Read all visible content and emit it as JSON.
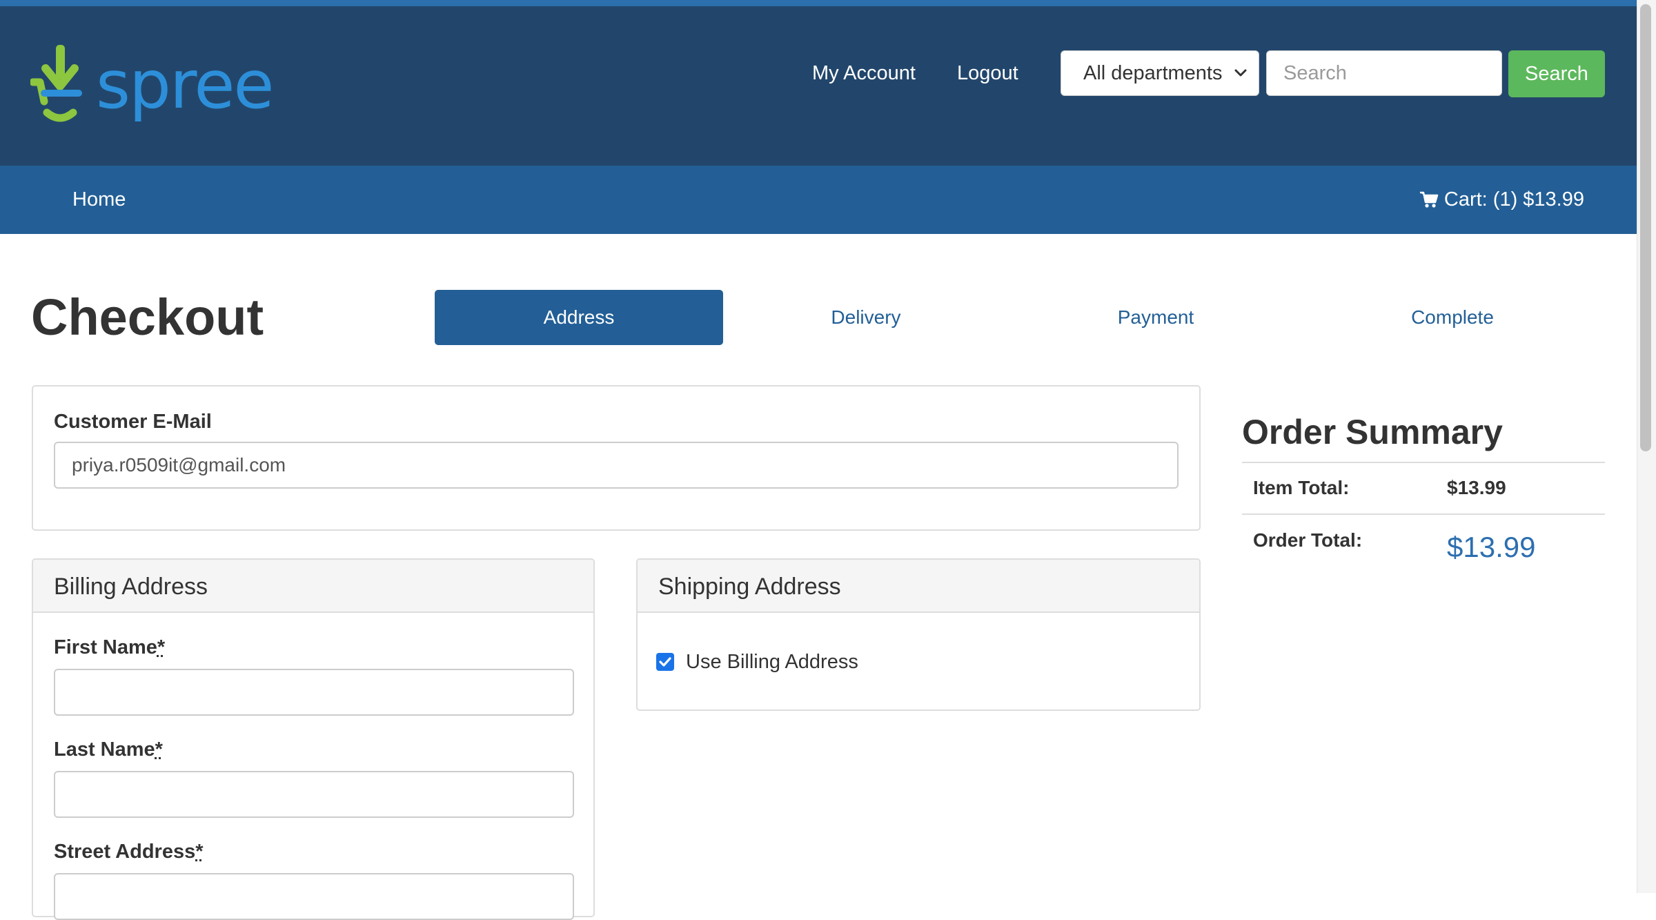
{
  "header": {
    "brand_name": "spree",
    "nav": {
      "my_account": "My Account",
      "logout": "Logout"
    },
    "search": {
      "department_selected": "All departments",
      "placeholder": "Search",
      "button_label": "Search"
    }
  },
  "navbar": {
    "home": "Home",
    "cart": "Cart: (1) $13.99"
  },
  "checkout": {
    "title": "Checkout",
    "steps": [
      {
        "label": "Address",
        "active": true
      },
      {
        "label": "Delivery",
        "active": false
      },
      {
        "label": "Payment",
        "active": false
      },
      {
        "label": "Complete",
        "active": false
      }
    ],
    "customer_email": {
      "label": "Customer E-Mail",
      "value": "priya.r0509it@gmail.com"
    },
    "billing": {
      "title": "Billing Address",
      "first_name_label": "First Name",
      "last_name_label": "Last Name",
      "street_label": "Street Address",
      "required_mark": "*"
    },
    "shipping": {
      "title": "Shipping Address",
      "use_billing_label": "Use Billing Address",
      "use_billing_checked": true
    }
  },
  "order_summary": {
    "title": "Order Summary",
    "item_total_label": "Item Total:",
    "item_total_value": "$13.99",
    "order_total_label": "Order Total:",
    "order_total_value": "$13.99"
  },
  "colors": {
    "header_bg": "#22466b",
    "navbar_bg": "#235f96",
    "search_button": "#5cb85c",
    "logo_green": "#8dc63f",
    "logo_blue": "#2d8fd9",
    "link": "#235f96"
  }
}
